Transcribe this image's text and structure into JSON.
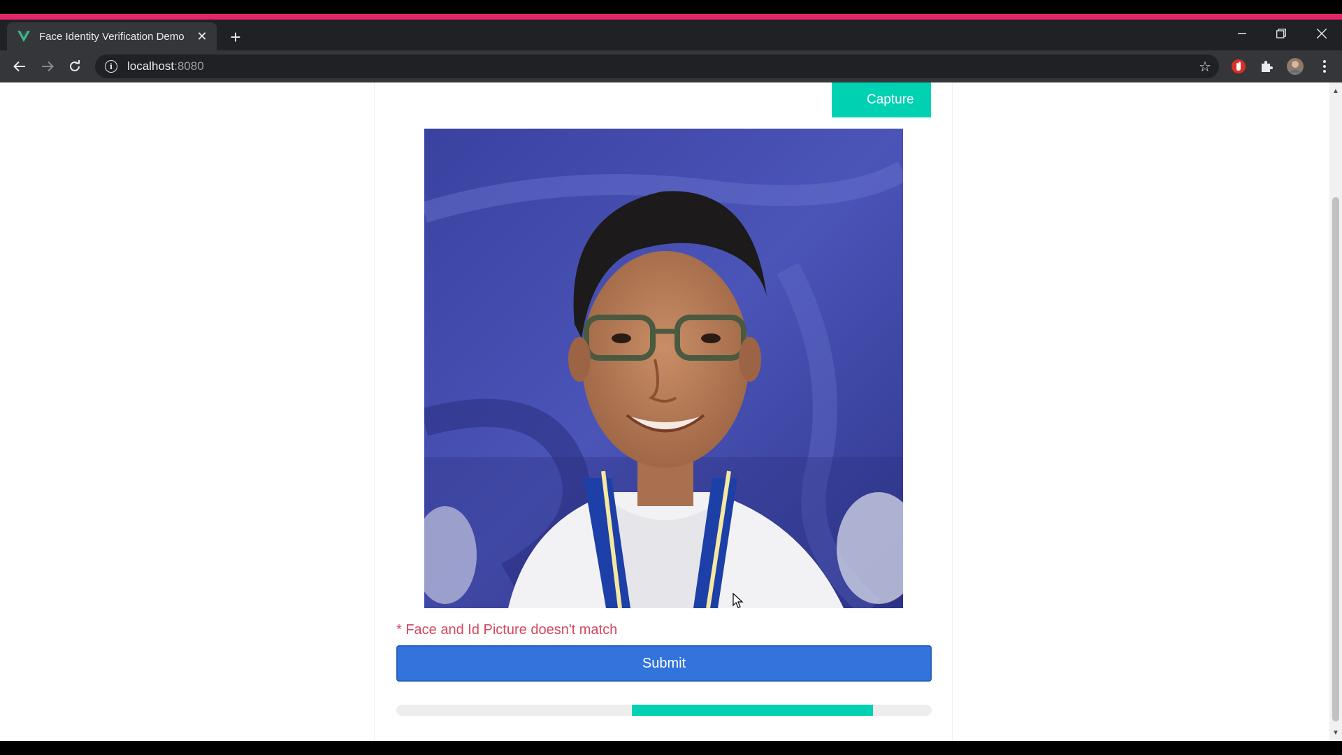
{
  "browser": {
    "tab_title": "Face Identity Verification Demo",
    "url_host": "localhost",
    "url_port": ":8080",
    "accent_color": "#e5256b"
  },
  "page": {
    "capture_label": "Capture",
    "error_message": "* Face and Id Picture doesn't match",
    "submit_label": "Submit",
    "progress": {
      "start": 0.44,
      "end": 0.89
    },
    "colors": {
      "primary": "#3273dc",
      "success": "#00d1b2",
      "danger": "#d1485f"
    }
  }
}
